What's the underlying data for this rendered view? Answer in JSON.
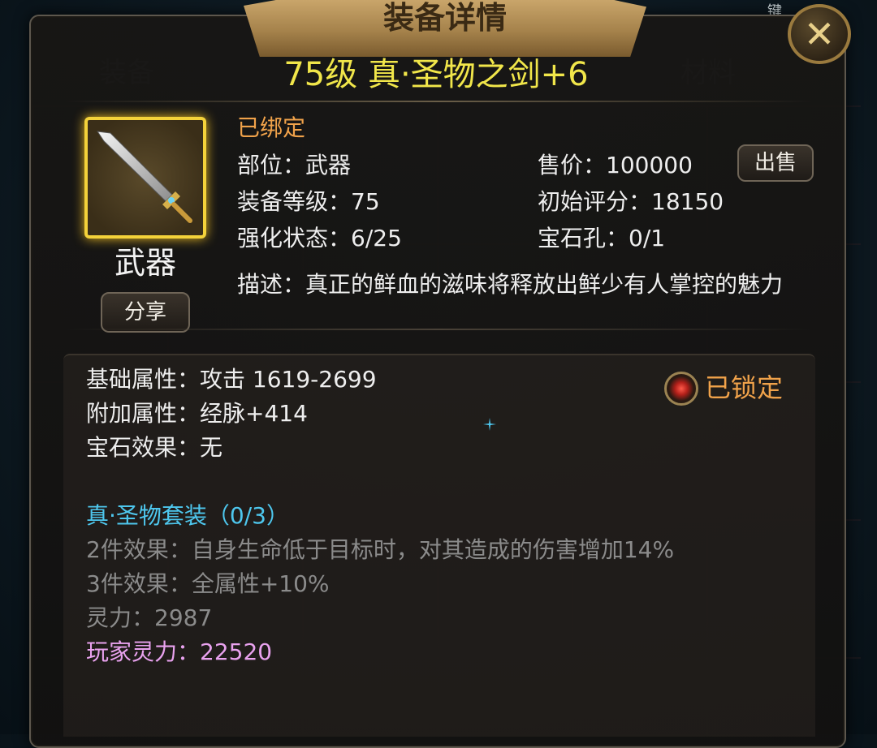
{
  "background": {
    "tabs": [
      "装备",
      "材料"
    ],
    "top_hint": "键"
  },
  "panel": {
    "banner_title": "装备详情",
    "close_icon": "close-icon"
  },
  "item": {
    "title": "75级 真·圣物之剑+6",
    "type": "武器",
    "bound_status": "已绑定",
    "share_label": "分享",
    "sell_label": "出售",
    "slot": "部位：武器",
    "level": "装备等级：75",
    "enhance": "强化状态：6/25",
    "price": "售价：100000",
    "initial_score": "初始评分：18150",
    "gem_slots": "宝石孔：0/1",
    "description": "描述：真正的鲜血的滋味将释放出鲜少有人掌控的魅力"
  },
  "attributes": {
    "base": "基础属性：攻击 1619-2699",
    "extra": "附加属性：经脉+414",
    "gem": "宝石效果：无",
    "locked": "已锁定"
  },
  "set": {
    "name": "真·圣物套装（0/3）",
    "effect2": "2件效果：自身生命低于目标时，对其造成的伤害增加14%",
    "effect3": "3件效果：全属性+10%",
    "spirit": "灵力：2987",
    "player_spirit": "玩家灵力：22520"
  },
  "colors": {
    "title": "#f1e64a",
    "bound": "#f0a24a",
    "set_name": "#4ec7ee",
    "player_spirit": "#e9a2ef"
  }
}
